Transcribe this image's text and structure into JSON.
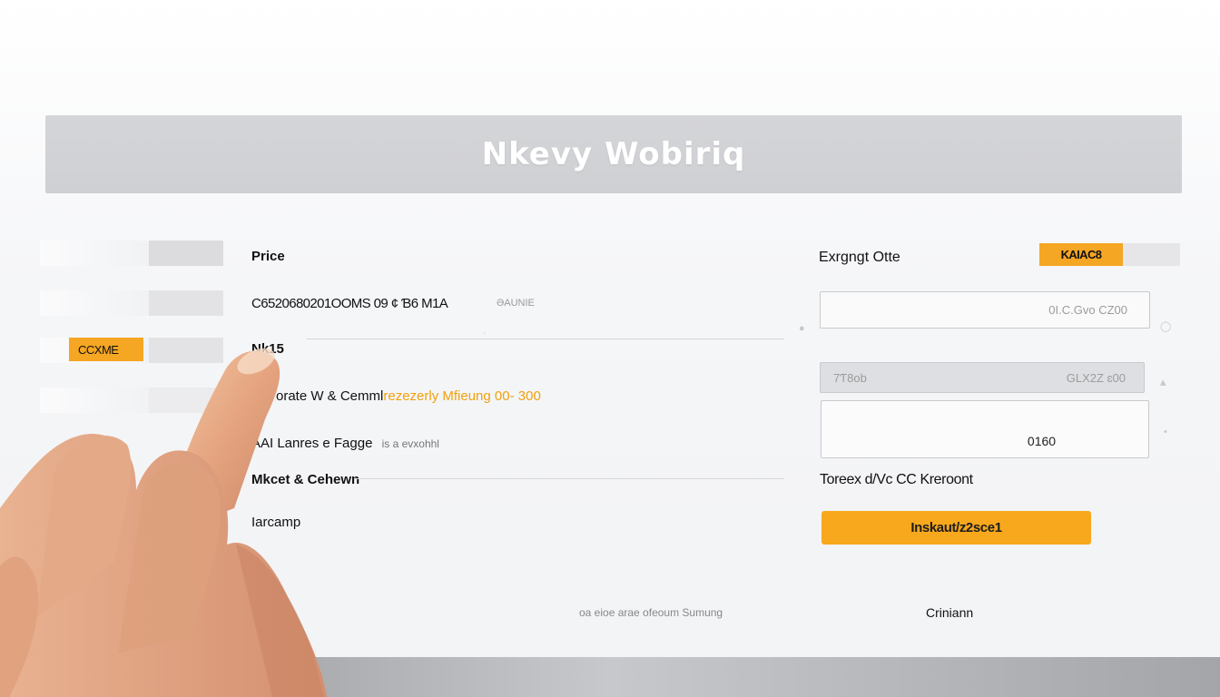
{
  "header": {
    "title": "Nkevy Wobiriq"
  },
  "sidebar": {
    "rows": [
      {
        "label": ""
      },
      {
        "label": ""
      },
      {
        "label": ""
      },
      {
        "label": ""
      }
    ],
    "active_label": "CCXME"
  },
  "main": {
    "price_label": "Price",
    "price_code": "C6520680201OOMS 09 ¢ Ɓ6 M1A",
    "price_aux": "ƏAUNIE",
    "row3_label": "Nk15",
    "row4_text": "orate W  & Cemml",
    "row4_accent": "rezezerly  Mfieung 00- 300",
    "row5_text": "AAI Lanres e  Fagge",
    "row5_sub": "is a evxohhl",
    "row6_text": "Mkcet & Cehewn",
    "row7_text": "Iarcamp",
    "footer_text": "oa eioe arae ofeoum Sumung"
  },
  "right_panel": {
    "title": "Exrgngt Otte",
    "badge": "KAIAC8",
    "field1_value": "0I.C.Gvo   CZ00",
    "field2_prefix": "7Ƭ8ob",
    "field2_value": "GLX2Z     ɛ00",
    "field3_value": "0160",
    "total_label": "Toreex d/Vc CC Kreroont",
    "cta_label": "Inskaut/z2sce1",
    "footer_link": "Criniann"
  },
  "colors": {
    "accent": "#f5a623",
    "header_bg": "#d2d3d6",
    "cta": "#f8a81c"
  }
}
